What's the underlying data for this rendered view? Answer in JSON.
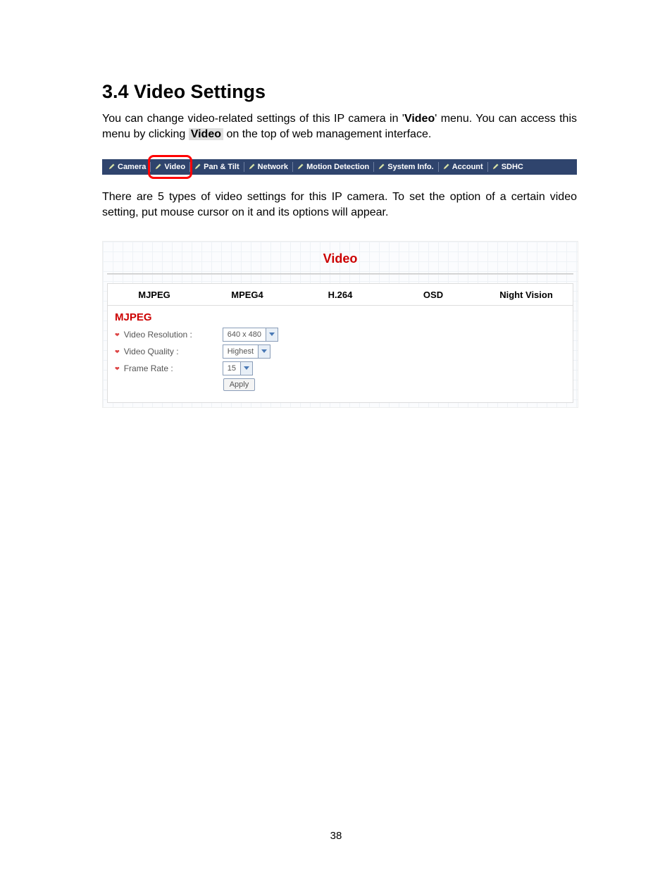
{
  "heading": "3.4  Video Settings",
  "paragraph1_pre": "You can change video-related settings of this IP camera in '",
  "paragraph1_bold": "Video",
  "paragraph1_post": "' menu. You can access this menu by clicking ",
  "paragraph1_btn": "Video",
  "paragraph1_tail": " on the top of web management interface.",
  "nav": {
    "items": [
      "Camera",
      "Video",
      "Pan & Tilt",
      "Network",
      "Motion Detection",
      "System Info.",
      "Account",
      "SDHC"
    ],
    "highlighted_index": 1
  },
  "paragraph2": "There are 5 types of video settings for this IP camera. To set the option of a certain video setting, put mouse cursor on it and its options will appear.",
  "panel": {
    "title": "Video",
    "tabs": [
      "MJPEG",
      "MPEG4",
      "H.264",
      "OSD",
      "Night Vision"
    ],
    "active_tab_title": "MJPEG",
    "rows": [
      {
        "label": "Video Resolution :",
        "value": "640 x 480"
      },
      {
        "label": "Video Quality :",
        "value": "Highest"
      },
      {
        "label": "Frame Rate :",
        "value": "15"
      }
    ],
    "apply_label": "Apply"
  },
  "page_number": "38"
}
